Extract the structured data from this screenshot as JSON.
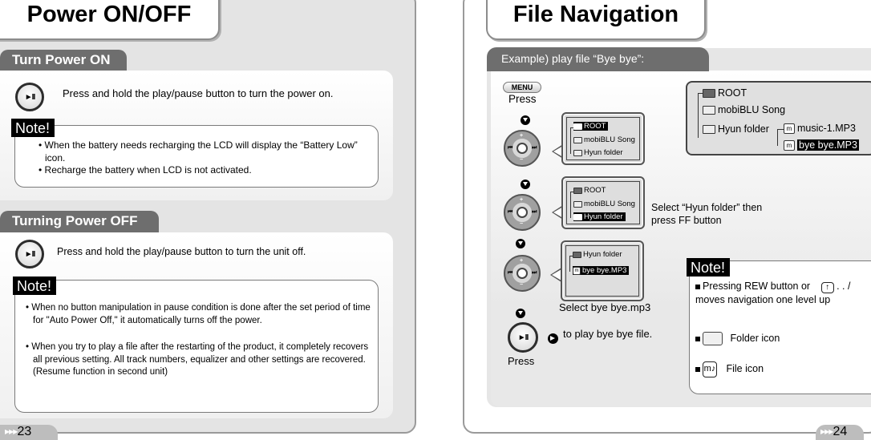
{
  "left_page": {
    "title": "Power ON/OFF",
    "page_number": "23",
    "sections": [
      {
        "heading": "Turn Power ON",
        "instruction": "Press and hold the play/pause button to turn the power on.",
        "play_button_glyph": "►II",
        "note_label": "Note!",
        "notes": [
          "When the battery needs recharging the LCD will display the  “Battery Low” icon.",
          "Recharge the battery when LCD is not activated."
        ]
      },
      {
        "heading": "Turning Power OFF",
        "instruction": "Press and hold the play/pause button to turn the unit off.",
        "play_button_glyph": "►II",
        "note_label": "Note!",
        "notes": [
          "When no button manipulation in pause condition is done after the set period of time for \"Auto Power Off,\" it automatically turns off the power.",
          "When you try to play a file after the restarting of the product, it completely recovers all previous setting. All track numbers, equalizer and other settings are recovered. (Resume function in second unit)"
        ]
      }
    ]
  },
  "right_page": {
    "title": "File Navigation",
    "page_number": "24",
    "example_heading": "Example) play file “Bye bye”:",
    "menu_button_label": "MENU",
    "press_label": "Press",
    "steps": [
      {
        "lcd_rows": [
          {
            "icon": "folder-open",
            "label": "ROOT",
            "selected": true
          },
          {
            "icon": "folder",
            "label": "mobiBLU Song",
            "selected": false
          },
          {
            "icon": "folder",
            "label": "Hyun folder",
            "selected": false
          }
        ],
        "caption": ""
      },
      {
        "lcd_rows": [
          {
            "icon": "folder-open",
            "label": "ROOT",
            "selected": false
          },
          {
            "icon": "folder",
            "label": "mobiBLU Song",
            "selected": false
          },
          {
            "icon": "folder",
            "label": "Hyun folder",
            "selected": true
          }
        ],
        "caption": "Select “Hyun folder” then press FF button"
      },
      {
        "lcd_rows": [
          {
            "icon": "folder-open",
            "label": "Hyun folder",
            "selected": false
          },
          {
            "icon": "file",
            "label": "bye bye.MP3",
            "selected": true
          }
        ],
        "caption": "Select bye bye.mp3"
      }
    ],
    "play_caption": "to play bye bye file.",
    "play_press_label": "Press",
    "tree": {
      "root": "ROOT",
      "folders": [
        "mobiBLU Song",
        "Hyun folder"
      ],
      "files": [
        {
          "label": "music-1.MP3",
          "selected": false
        },
        {
          "label": "bye bye.MP3",
          "selected": true
        }
      ]
    },
    "note": {
      "label": "Note!",
      "items": [
        "Pressing REW button or",
        ". . / moves navigation one  level up",
        "Folder icon",
        "File icon"
      ],
      "file_icon_glyph": "m♪",
      "up_icon_glyph": "↑"
    },
    "wheel": {
      "plus": "+",
      "minus": "−",
      "rew": "⏮",
      "ff": "⏭",
      "center": "►‖"
    }
  }
}
